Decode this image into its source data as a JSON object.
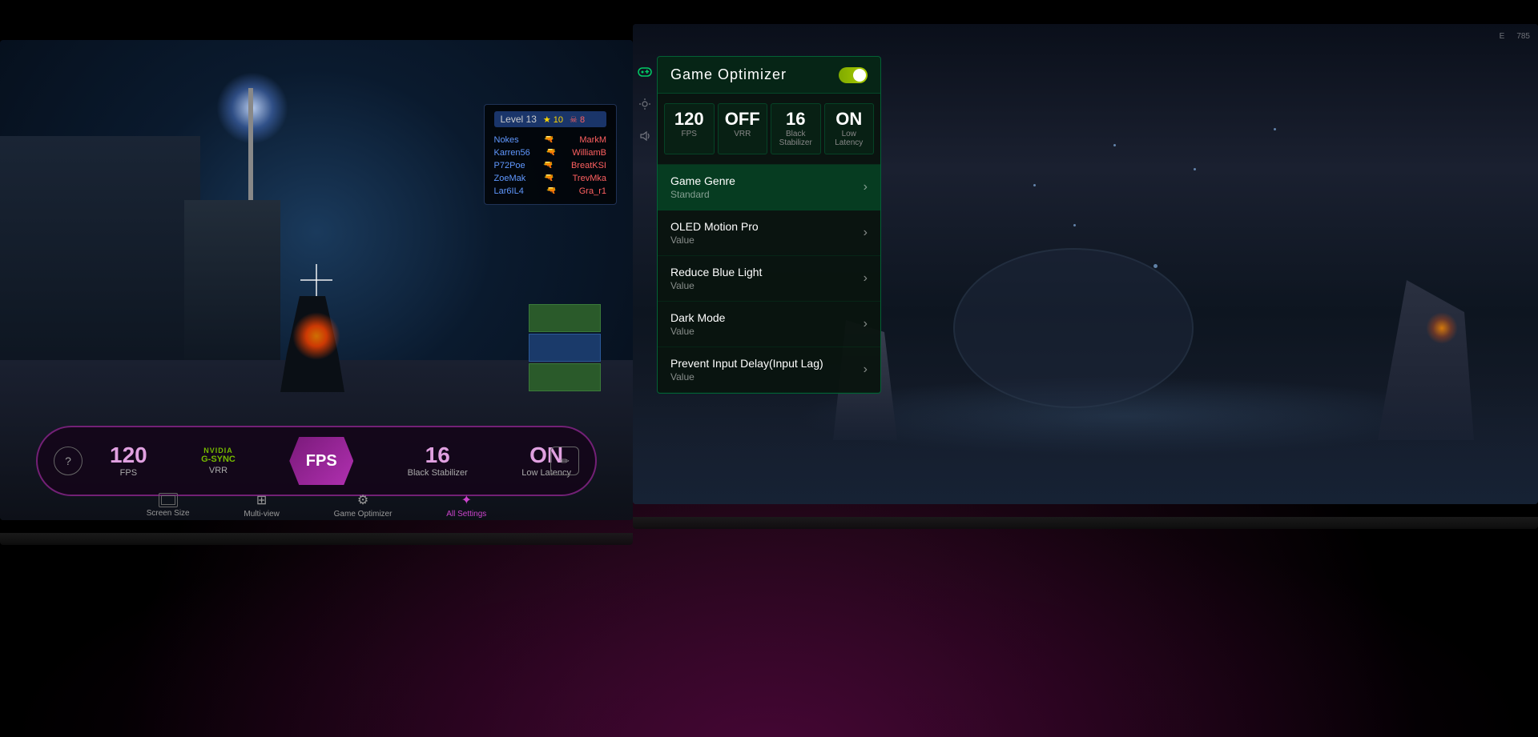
{
  "left_screen": {
    "scoreboard": {
      "level_label": "Level 13",
      "star_count": "★ 10",
      "skull_count": "☠ 8",
      "players": [
        {
          "name": "Nokes",
          "opponent": "MarkM",
          "team": "blue"
        },
        {
          "name": "Karren56",
          "opponent": "WilliamB",
          "team": "blue"
        },
        {
          "name": "P72Poe",
          "opponent": "BreatKSI",
          "team": "red"
        },
        {
          "name": "ZoeMak",
          "opponent": "TrevMka",
          "team": "red"
        },
        {
          "name": "Lar6IL4",
          "opponent": "Gra_r1",
          "team": "blue"
        }
      ]
    },
    "hud": {
      "fps_value": "120",
      "fps_label": "FPS",
      "vrr_value": "VRR",
      "vrr_sub": "NVIDIA",
      "vrr_gsync": "G-SYNC",
      "fps_center": "FPS",
      "black_stab_value": "16",
      "black_stab_label": "Black Stabilizer",
      "low_latency_value": "ON",
      "low_latency_label": "Low Latency"
    },
    "toolbar": {
      "help_icon": "?",
      "screen_size_label": "Screen Size",
      "multiview_label": "Multi-view",
      "game_optimizer_label": "Game Optimizer",
      "all_settings_label": "All Settings",
      "edit_icon": "✏"
    }
  },
  "right_screen": {
    "sidebar_icons": [
      {
        "name": "gamepad-icon",
        "active": true
      },
      {
        "name": "brightness-icon",
        "active": false
      },
      {
        "name": "volume-icon",
        "active": false
      }
    ],
    "map": {
      "top_label": "E",
      "coord_label": "785"
    },
    "panel": {
      "title": "Game Optimizer",
      "toggle_state": "ON",
      "stats": [
        {
          "value": "120",
          "label": "FPS"
        },
        {
          "value": "OFF",
          "label": "VRR"
        },
        {
          "value": "16",
          "label": "Black Stabilizer"
        },
        {
          "value": "ON",
          "label": "Low Latency"
        }
      ],
      "menu_items": [
        {
          "title": "Game Genre",
          "value": "Standard",
          "active": true
        },
        {
          "title": "OLED Motion Pro",
          "value": "Value",
          "active": false
        },
        {
          "title": "Reduce Blue Light",
          "value": "Value",
          "active": false
        },
        {
          "title": "Dark Mode",
          "value": "Value",
          "active": false
        },
        {
          "title": "Prevent Input Delay(Input Lag)",
          "value": "Value",
          "active": false
        }
      ]
    }
  },
  "colors": {
    "accent_left": "#cc44cc",
    "accent_right": "#00cc66",
    "panel_bg": "rgba(10,20,15,0.95)",
    "hud_bg": "rgba(20,5,25,0.85)"
  }
}
